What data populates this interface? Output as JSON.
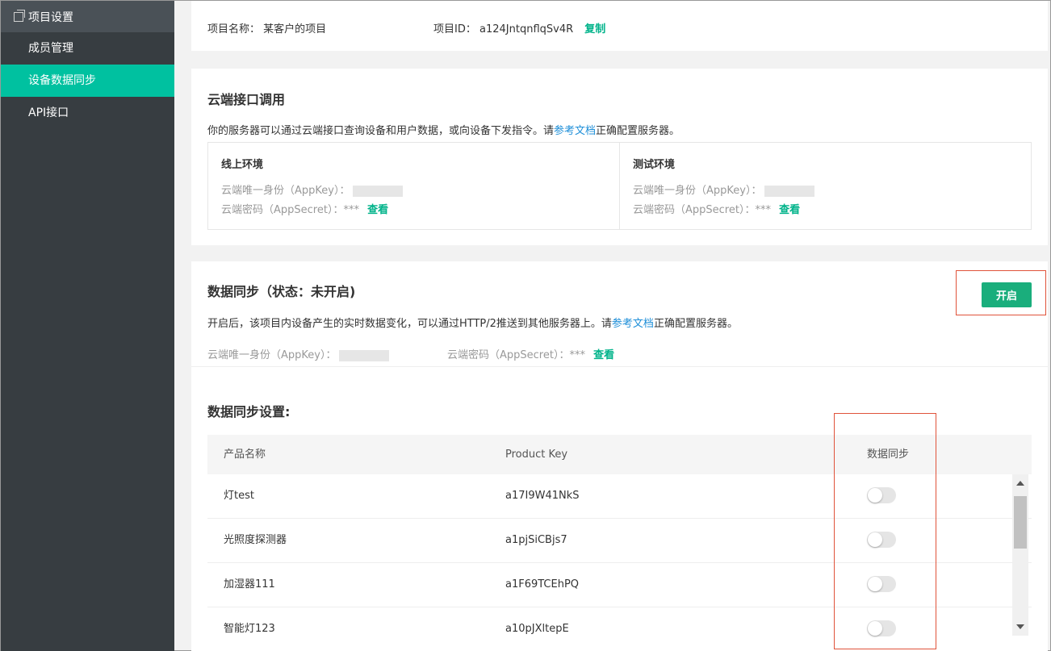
{
  "sidebar": {
    "header": "项目设置",
    "items": [
      {
        "label": "成员管理"
      },
      {
        "label": "设备数据同步"
      },
      {
        "label": "API接口"
      }
    ]
  },
  "project": {
    "name_label": "项目名称：",
    "name_value": "某客户的项目",
    "id_label": "项目ID：",
    "id_value": "a124JntqnflqSv4R",
    "copy_label": "复制"
  },
  "cloud_api": {
    "title": "云端接口调用",
    "desc_pre": "你的服务器可以通过云端接口查询设备和用户数据，或向设备下发指令。请",
    "doc_link": "参考文档",
    "desc_post": "正确配置服务器。",
    "online": {
      "title": "线上环境",
      "appkey_label": "云端唯一身份（AppKey）：",
      "secret_label": "云端密码（AppSecret）：***",
      "view_label": "查看"
    },
    "test": {
      "title": "测试环境",
      "appkey_label": "云端唯一身份（AppKey）：",
      "secret_label": "云端密码（AppSecret）：***",
      "view_label": "查看"
    }
  },
  "data_sync": {
    "title": "数据同步（状态：未开启)",
    "open_button": "开启",
    "desc_pre": "开启后，该项目内设备产生的实时数据变化，可以通过HTTP/2推送到其他服务器上。请",
    "doc_link": "参考文档",
    "desc_post": "正确配置服务器。",
    "appkey_label": "云端唯一身份（AppKey）：",
    "secret_label": "云端密码（AppSecret）：***",
    "view_label": "查看"
  },
  "sync_settings": {
    "title": "数据同步设置:",
    "columns": [
      "产品名称",
      "Product Key",
      "数据同步"
    ],
    "rows": [
      {
        "name": "灯test",
        "key": "a17I9W41NkS",
        "sync": false
      },
      {
        "name": "光照度探测器",
        "key": "a1pjSiCBjs7",
        "sync": false
      },
      {
        "name": "加湿器111",
        "key": "a1F69TCEhPQ",
        "sync": false
      },
      {
        "name": "智能灯123",
        "key": "a10pJXltepE",
        "sync": false
      }
    ]
  },
  "colors": {
    "sidebar_bg": "#373d41",
    "active_item": "#00c1a0",
    "primary_button": "#1aae7c",
    "link_blue": "#1d8ed8",
    "highlight_red": "#e0533a"
  }
}
